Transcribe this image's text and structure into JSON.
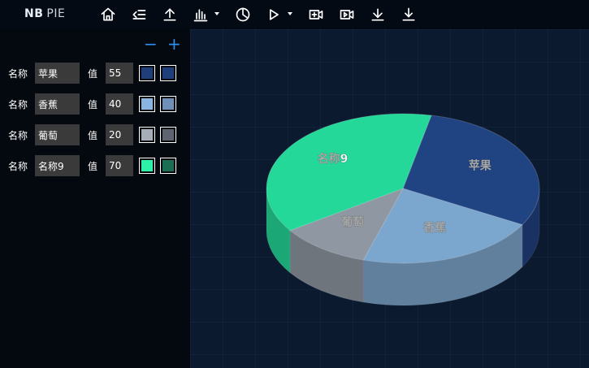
{
  "app": {
    "brand_bold": "NB",
    "brand_rest": "PIE"
  },
  "toolbar": {
    "icons": [
      "home-icon",
      "collapse-list-icon",
      "upload-icon",
      "bar-chart-icon",
      "pie-chart-icon",
      "play-icon",
      "add-video-icon",
      "video-icon",
      "download-icon",
      "download-alt-icon"
    ]
  },
  "sidebar": {
    "minus": "−",
    "plus": "+",
    "name_label": "名称",
    "value_label": "值",
    "rows": [
      {
        "name": "苹果",
        "value": "55",
        "color1": "#1f3f7a",
        "color2": "#1f3f7a"
      },
      {
        "name": "香蕉",
        "value": "40",
        "color1": "#8ab4e0",
        "color2": "#6f8fb8"
      },
      {
        "name": "葡萄",
        "value": "20",
        "color1": "#a8aeb8",
        "color2": "#5d6470"
      },
      {
        "name": "名称9",
        "value": "70",
        "color1": "#2ef0a8",
        "color2": "#1c6e52"
      }
    ]
  },
  "chart_data": {
    "type": "pie",
    "slices": [
      {
        "name": "苹果",
        "value": 55,
        "color": "#23468a"
      },
      {
        "name": "香蕉",
        "value": 40,
        "color": "#85b2dc"
      },
      {
        "name": "葡萄",
        "value": 20,
        "color": "#9aa2ad"
      },
      {
        "name": "名称9",
        "value": 70,
        "color": "#27e8a4"
      }
    ]
  }
}
